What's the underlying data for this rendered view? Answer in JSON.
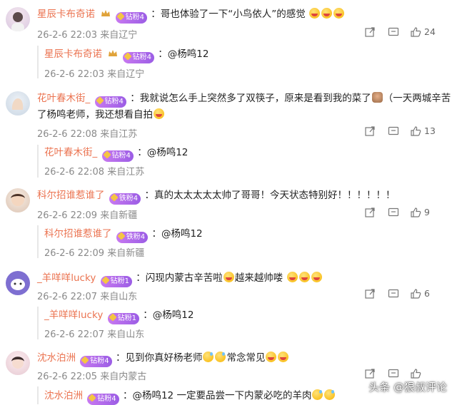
{
  "comments": [
    {
      "username": "星辰卡布奇诺",
      "badge": "钻粉4",
      "text_before": "：哥也体验了一下“小鸟依人”的感觉",
      "text_after": "",
      "meta": "26-2-6 22:03 来自辽宁",
      "likes": "24",
      "reply": {
        "username": "星辰卡布奇诺",
        "badge": "钻粉4",
        "text": "：@杨鸣12",
        "meta": "26-2-6 22:03 来自辽宁"
      }
    },
    {
      "username": "花叶春木街_",
      "badge": "钻粉4",
      "text_before": "：我就说怎么手上突然多了双筷子，原来是看到我的菜了",
      "text_mid": "（一天两城辛苦",
      "text_line2": "了杨鸣老师，我还想看自拍",
      "meta": "26-2-6 22:08 来自江苏",
      "likes": "13",
      "reply": {
        "username": "花叶春木街_",
        "badge": "钻粉4",
        "text": "：@杨鸣12",
        "meta": "26-2-6 22:08 来自江苏"
      }
    },
    {
      "username": "科尔招谁惹谁了",
      "badge": "铁粉4",
      "text_before": "：真的太太太太太帅了哥哥！今天状态特别好！！！！！！",
      "meta": "26-2-6 22:09 来自新疆",
      "likes": "9",
      "reply": {
        "username": "科尔招谁惹谁了",
        "badge": "铁粉4",
        "text": "：@杨鸣12",
        "meta": "26-2-6 22:09 来自新疆"
      }
    },
    {
      "username": "_羊咩咩lucky",
      "badge": "钻粉1",
      "text_before": "：闪现内蒙古辛苦啦",
      "text_mid": "越来越帅喽",
      "meta": "26-2-6 22:07 来自山东",
      "likes": "6",
      "reply": {
        "username": "_羊咩咩lucky",
        "badge": "钻粉1",
        "text": "：@杨鸣12",
        "meta": "26-2-6 22:07 来自山东"
      }
    },
    {
      "username": "沈水泊洲",
      "badge": "钻粉4",
      "text_before": "：见到你真好杨老师",
      "text_mid": "常念常见",
      "meta": "26-2-6 22:05 来自内蒙古",
      "likes": "",
      "reply": {
        "username": "沈水泊洲",
        "badge": "钻粉4",
        "text": "：@杨鸣12 一定要品尝一下内蒙必吃的羊肉",
        "meta": ""
      }
    }
  ],
  "watermark": "头条 @狠叔评论",
  "colors": {
    "username": "#eb7350",
    "meta": "#8a8a8a",
    "badge": "#a86be8"
  },
  "icons": [
    "share-icon",
    "comment-icon",
    "like-icon",
    "crown-icon",
    "gem-icon"
  ]
}
